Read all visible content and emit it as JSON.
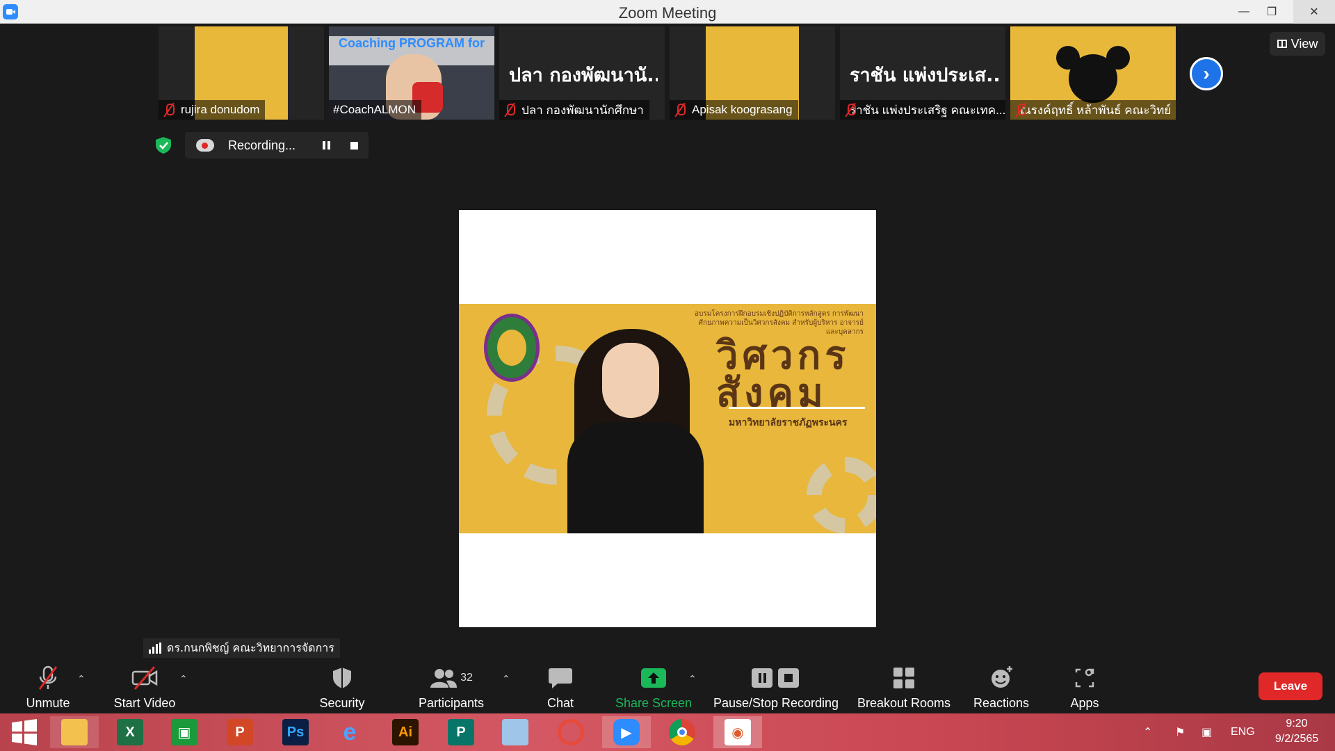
{
  "window": {
    "title": "Zoom Meeting"
  },
  "participants": [
    {
      "name": "rujira donudom",
      "muted": true
    },
    {
      "name": "#CoachALMON",
      "muted": false,
      "overlay": "Coaching PROGRAM for ...er"
    },
    {
      "name": "ปลา กองพัฒนานักศึกษา",
      "muted": true,
      "display": "ปลา กองพัฒนานั..."
    },
    {
      "name": "Apisak koograsang",
      "muted": true
    },
    {
      "name": "ราชัน แพ่งประเสริฐ คณะเทค...",
      "muted": true,
      "display": "ราชัน แพ่งประเส..."
    },
    {
      "name": "ณรงค์ฤทธิ์ หล้าพันธ์ คณะวิทย์",
      "muted": true
    }
  ],
  "view_button": {
    "label": "View"
  },
  "recording": {
    "label": "Recording..."
  },
  "active_speaker": {
    "name": "ดร.กนกพิชญ์ คณะวิทยาการจัดการ",
    "banner_heading": "อบรมโครงการฝึกอบรมเชิงปฏิบัติการหลักสูตร การพัฒนาศักยภาพความเป็นวิศวกรสังคม สำหรับผู้บริหาร อาจารย์ และบุคลากร",
    "banner_logo_line1": "วิศวกร",
    "banner_logo_line2": "สังคม",
    "banner_university": "มหาวิทยาลัยราชภัฏพระนคร"
  },
  "toolbar": {
    "unmute": "Unmute",
    "start_video": "Start Video",
    "security": "Security",
    "participants": "Participants",
    "participants_count": "32",
    "chat": "Chat",
    "share_screen": "Share Screen",
    "pause_stop_recording": "Pause/Stop Recording",
    "breakout_rooms": "Breakout Rooms",
    "reactions": "Reactions",
    "apps": "Apps",
    "leave": "Leave"
  },
  "taskbar": {
    "language": "ENG",
    "time": "9:20",
    "date": "9/2/2565"
  },
  "colors": {
    "accent": "#2d8cff",
    "share_green": "#1bb85a",
    "leave_red": "#e02828",
    "banner_yellow": "#e8b73b"
  }
}
